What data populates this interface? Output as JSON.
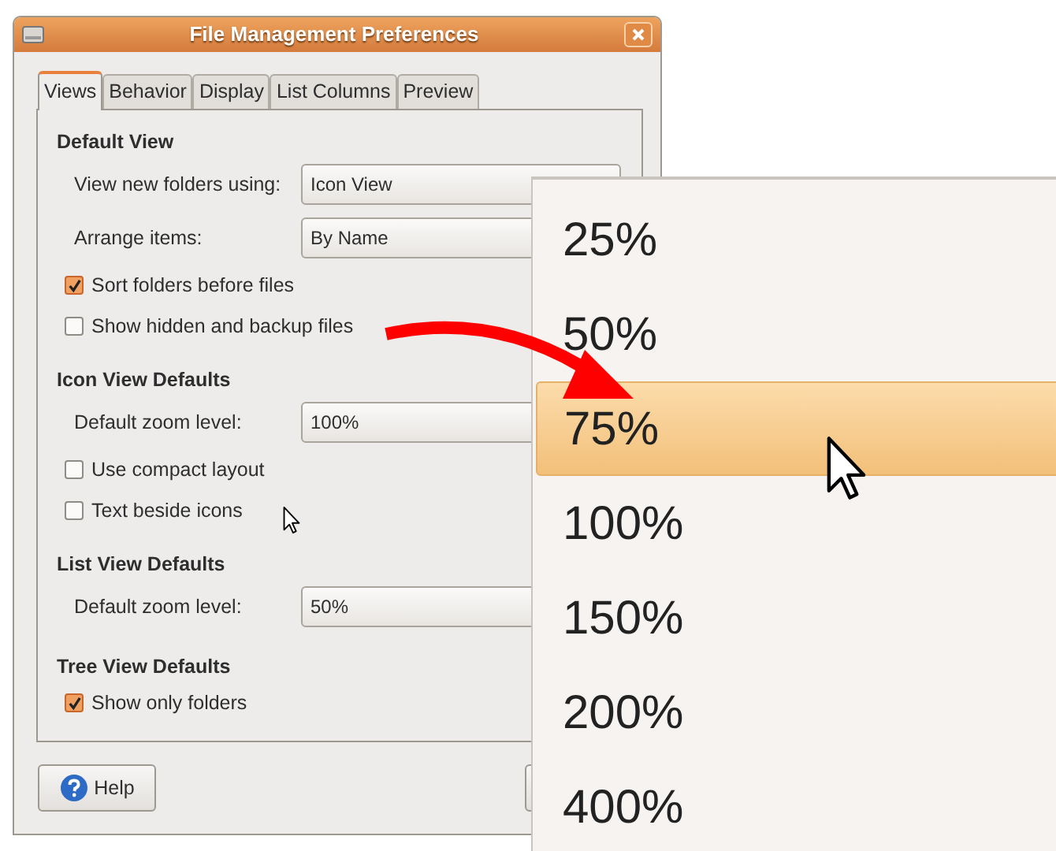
{
  "window": {
    "title": "File Management Preferences"
  },
  "tabs": [
    {
      "label": "Views",
      "selected": true
    },
    {
      "label": "Behavior",
      "selected": false
    },
    {
      "label": "Display",
      "selected": false
    },
    {
      "label": "List Columns",
      "selected": false
    },
    {
      "label": "Preview",
      "selected": false
    }
  ],
  "sections": [
    {
      "heading": "Default View",
      "rows": [
        {
          "kind": "combo",
          "label": "View new folders using:",
          "value": "Icon View"
        },
        {
          "kind": "combo",
          "label": "Arrange items:",
          "value": "By Name"
        },
        {
          "kind": "checkbox",
          "label": "Sort folders before files",
          "checked": true
        },
        {
          "kind": "checkbox",
          "label": "Show hidden and backup files",
          "checked": false
        }
      ]
    },
    {
      "heading": "Icon View Defaults",
      "rows": [
        {
          "kind": "combo",
          "label": "Default zoom level:",
          "value": "100%"
        },
        {
          "kind": "checkbox",
          "label": "Use compact layout",
          "checked": false
        },
        {
          "kind": "checkbox",
          "label": "Text beside icons",
          "checked": false
        }
      ]
    },
    {
      "heading": "List View Defaults",
      "rows": [
        {
          "kind": "combo",
          "label": "Default zoom level:",
          "value": "50%"
        }
      ]
    },
    {
      "heading": "Tree View Defaults",
      "rows": [
        {
          "kind": "checkbox",
          "label": "Show only folders",
          "checked": true
        }
      ]
    }
  ],
  "help_button": {
    "label": "Help"
  },
  "zoom_menu": {
    "items": [
      {
        "label": "25%",
        "selected": false
      },
      {
        "label": "50%",
        "selected": false
      },
      {
        "label": "75%",
        "selected": true
      },
      {
        "label": "100%",
        "selected": false
      },
      {
        "label": "150%",
        "selected": false
      },
      {
        "label": "200%",
        "selected": false
      },
      {
        "label": "400%",
        "selected": false
      }
    ]
  }
}
